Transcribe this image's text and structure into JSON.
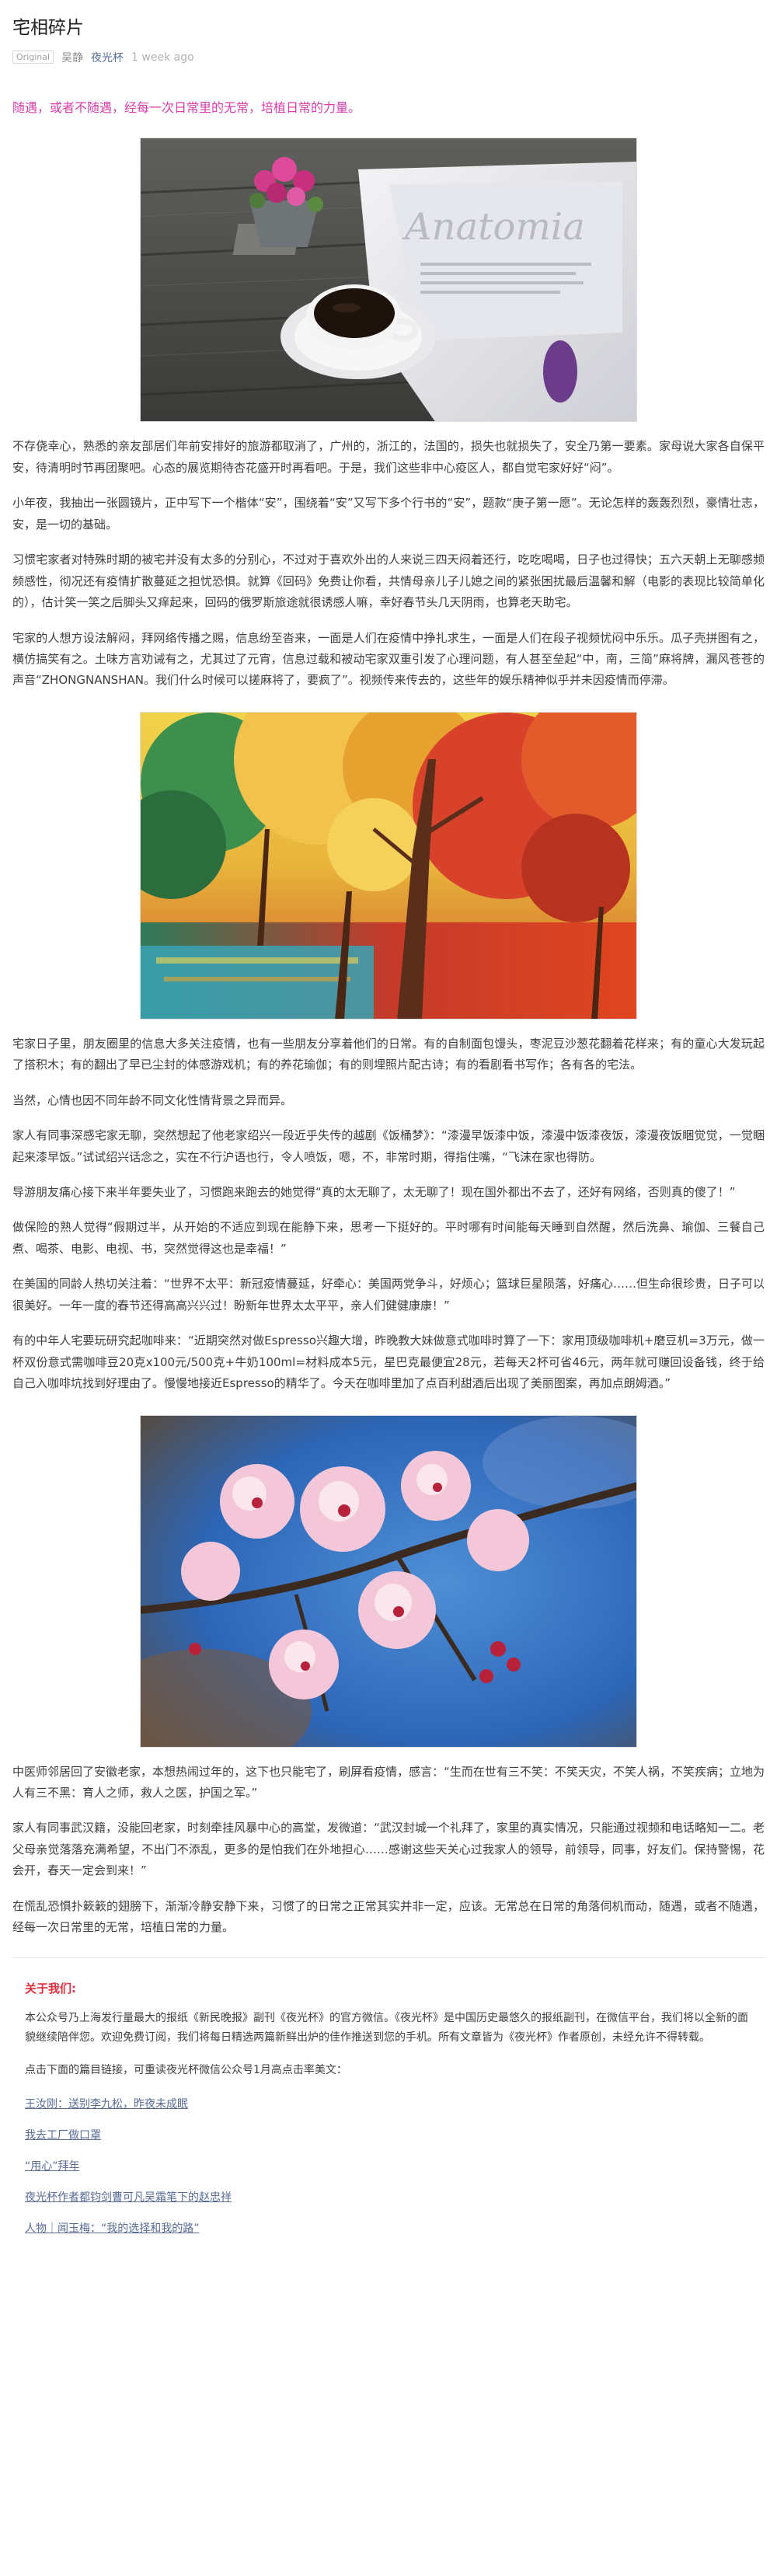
{
  "header": {
    "title": "宅相碎片",
    "original_tag": "Original",
    "author": "吴静",
    "account": "夜光杯",
    "time": "1 week ago"
  },
  "article": {
    "lead": "随遇，或者不随遇，经每一次日常里的无常，培植日常的力量。",
    "paragraphs": [
      "不存侥幸心，熟悉的亲友部居们年前安排好的旅游都取消了，广州的，浙江的，法国的，损失也就损失了，安全乃第一要素。家母说大家各自保平安，待清明时节再团聚吧。心态的展览期待杏花盛开时再看吧。于是，我们这些非中心疫区人，都自觉宅家好好“闷”。",
      "小年夜，我抽出一张圆镜片，正中写下一个楷体“安”，围绕着“安”又写下多个行书的“安”，题款“庚子第一愿”。无论怎样的轰轰烈烈，豪情壮志，安，是一切的基础。",
      "习惯宅家者对特殊时期的被宅并没有太多的分别心，不过对于喜欢外出的人来说三四天闷着还行，吃吃喝喝，日子也过得快；五六天朝上无聊感频频感性，彻况还有疫情扩散蔓延之担忧恐惧。就算《回码》免费让你看，共情母亲儿子儿媳之间的紧张困扰最后温馨和解（电影的表现比较简单化的），估计笑一笑之后脚头又痒起来，回码的俄罗斯旅途就很诱感人嘛，幸好春节头几天阴雨，也算老天助宅。",
      "宅家的人想方设法解闷，拜网络传播之赐，信息纷至沓来，一面是人们在疫情中挣扎求生，一面是人们在段子视频忧闷中乐乐。瓜子壳拼图有之，横仿搞笑有之。土味方言劝诫有之，尤其过了元宵，信息过载和被动宅家双重引发了心理问题，有人甚至垒起“中，南，三简”麻将牌，漏风苍苍的声音“ZHONGNANSHAN。我们什么时候可以搓麻将了，要疯了”。视频传来传去的，这些年的娱乐精神似乎并未因疫情而停滞。",
      "宅家日子里，朋友圈里的信息大多关注疫情，也有一些朋友分享着他们的日常。有的自制面包馒头，枣泥豆沙葱花翻着花样来；有的童心大发玩起了搭积木；有的翻出了早已尘封的体感游戏机；有的养花瑜伽；有的则埋照片配古诗；有的看剧看书写作；各有各的宅法。",
      "当然，心情也因不同年龄不同文化性情背景之异而异。",
      "家人有同事深感宅家无聊，突然想起了他老家绍兴一段近乎失传的越剧《饭桶梦》：“漆漫早饭漆中饭，漆漫中饭漆夜饭，漆漫夜饭睏觉觉，一觉睏起来漆早饭。”试试绍兴话念之，实在不行沪语也行，令人喷饭，嗯，不，非常时期，得指住嘴，“飞沫在家也得防。",
      "导游朋友痛心接下来半年要失业了，习惯跑来跑去的她觉得“真的太无聊了，太无聊了！现在国外都出不去了，还好有网络，否则真的傻了！”",
      "做保险的熟人觉得“假期过半，从开始的不适应到现在能静下来，思考一下挺好的。平时哪有时间能每天睡到自然醒，然后洗鼻、瑜伽、三餐自己煮、喝茶、电影、电视、书，突然觉得这也是幸福！”",
      "在美国的同龄人热切关注着：“世界不太平：新冠疫情蔓延，好牵心：美国两党争斗，好烦心；篮球巨星陨落，好痛心……但生命很珍贵，日子可以很美好。一年一度的春节还得高高兴兴过！盼新年世界太太平平，亲人们健健康康！”",
      "有的中年人宅要玩研究起咖啡来：“近期突然对做Espresso兴趣大增，昨晚教大妹做意式咖啡时算了一下：家用顶级咖啡机+磨豆机=3万元，做一杯双份意式需咖啡豆20克x100元/500克+牛奶100ml=材料成本5元，星巴克最便宜28元，若每天2杯可省46元，两年就可赚回设备钱，终于给自己入咖啡坑找到好理由了。慢慢地接近Espresso的精华了。今天在咖啡里加了点百利甜酒后出现了美丽图案，再加点朗姆酒。”",
      "中医师邻居回了安徽老家，本想热闹过年的，这下也只能宅了，刷屏看疫情，感言：“生而在世有三不笑：不笑天灾，不笑人祸，不笑疾病；立地为人有三不黑：育人之师，救人之医，护国之军。”",
      "家人有同事武汉籍，没能回老家，时刻牵挂风暴中心的高堂，发微道：“武汉封城一个礼拜了，家里的真实情况，只能通过视频和电话略知一二。老父母亲觉落落充满希望，不出门不添乱，更多的是怕我们在外地担心……感谢这些天关心过我家人的领导，前领导，同事，好友们。保持警惕，花会开，春天一定会到来！”",
      "在慌乱恐惧扑簌簌的翅膀下，渐渐冷静安静下来，习惯了的日常之正常其实并非一定，应该。无常总在日常的角落伺机而动，随遇，或者不随遇，经每一次日常里的无常，培植日常的力量。"
    ]
  },
  "images": {
    "img1": "coffee-and-magazine-photo",
    "img2": "autumn-forest-painting",
    "img3": "cherry-blossom-photo",
    "magazine_word": "Anatomia"
  },
  "about": {
    "heading": "关于我们:",
    "intro": "本公众号乃上海发行量最大的报纸《新民晚报》副刊《夜光杯》的官方微信。《夜光杯》是中国历史最悠久的报纸副刊，在微信平台，我们将以全新的面貌继续陪伴您。欢迎免费订阅，我们将每日精选两篇新鲜出炉的佳作推送到您的手机。所有文章皆为《夜光杯》作者原创，未经允许不得转载。",
    "prompt": "点击下面的篇目链接，可重读夜光杯微信公众号1月高点击率美文：",
    "links": [
      "王汝刚：送别李九松，昨夜未成眠",
      "我去工厂做口罩",
      "“用心”拜年",
      "夜光杯作者都钧剑曹可凡吴霜笔下的赵忠祥",
      "人物｜闻玉梅：“我的选择和我的路”"
    ]
  },
  "colors": {
    "lead": "#d63ea9",
    "link": "#576b95",
    "about_heading": "#e0303f"
  }
}
